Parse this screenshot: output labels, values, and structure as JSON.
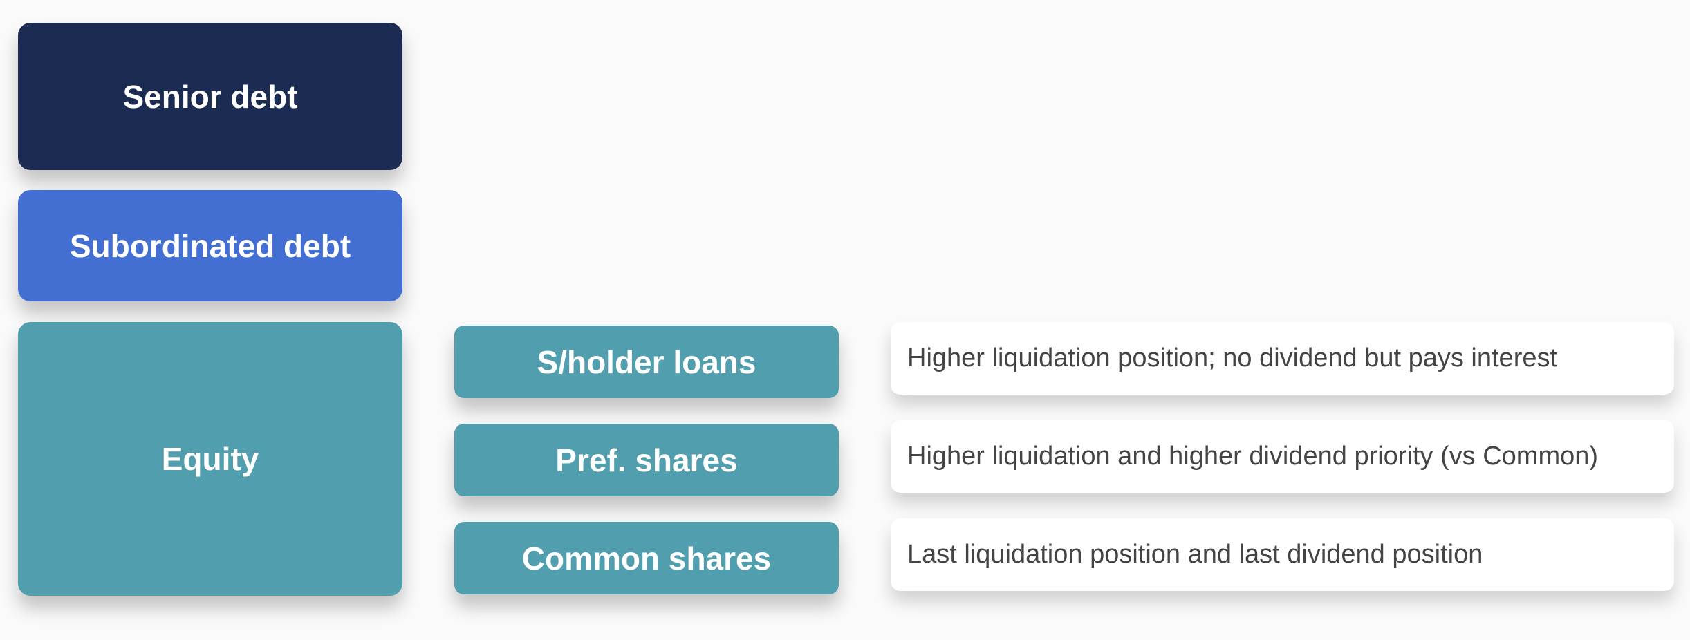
{
  "capital_structure": {
    "tiers": {
      "senior": {
        "label": "Senior debt",
        "color": "#1b2b52"
      },
      "subordinated": {
        "label": "Subordinated debt",
        "color": "#446fd2"
      },
      "equity": {
        "label": "Equity",
        "color": "#519fae"
      }
    },
    "equity_components": [
      {
        "label": "S/holder loans",
        "description": "Higher liquidation position; no dividend but pays interest"
      },
      {
        "label": "Pref. shares",
        "description": "Higher liquidation and higher dividend priority (vs Common)"
      },
      {
        "label": "Common shares",
        "description": "Last liquidation position and last dividend position"
      }
    ]
  }
}
